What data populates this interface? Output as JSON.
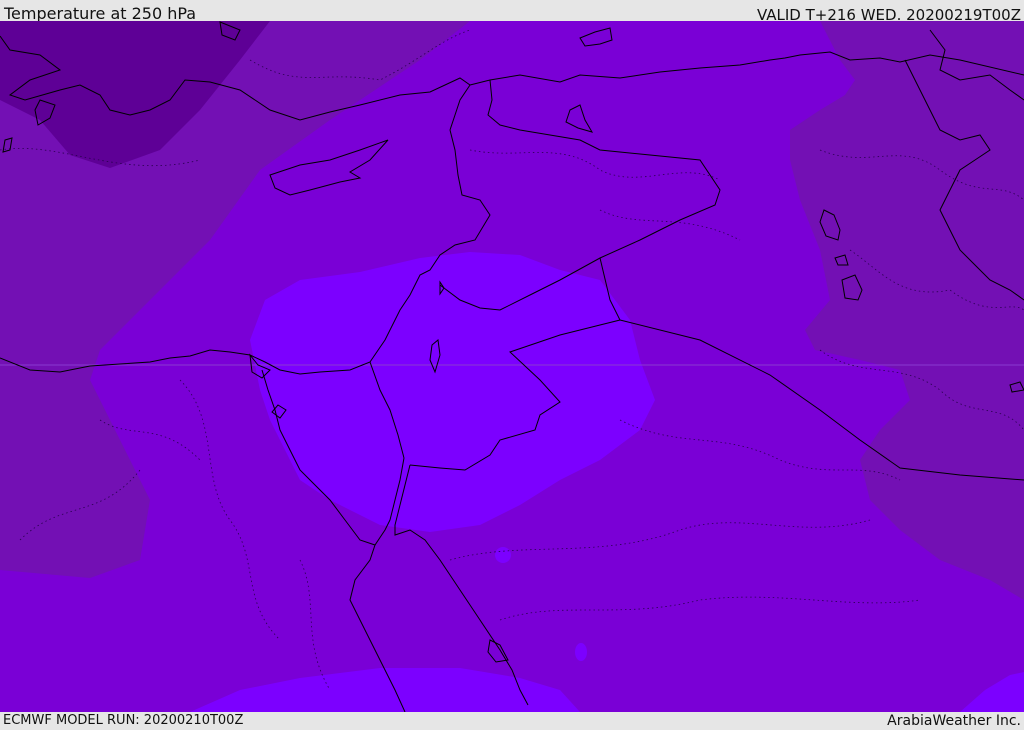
{
  "header": {
    "title": "Temperature at 250 hPa",
    "valid": "VALID T+216 WED. 20200219T00Z"
  },
  "footer": {
    "model_run": "ECMWF MODEL RUN: 20200210T00Z",
    "credit": "ArabiaWeather Inc."
  },
  "colors": {
    "coldest": "#5e0096",
    "cold": "#7310b4",
    "mid": "#7a00d6",
    "warm": "#7c00ff",
    "coast": "#000000",
    "background": "#e6e6e6"
  }
}
